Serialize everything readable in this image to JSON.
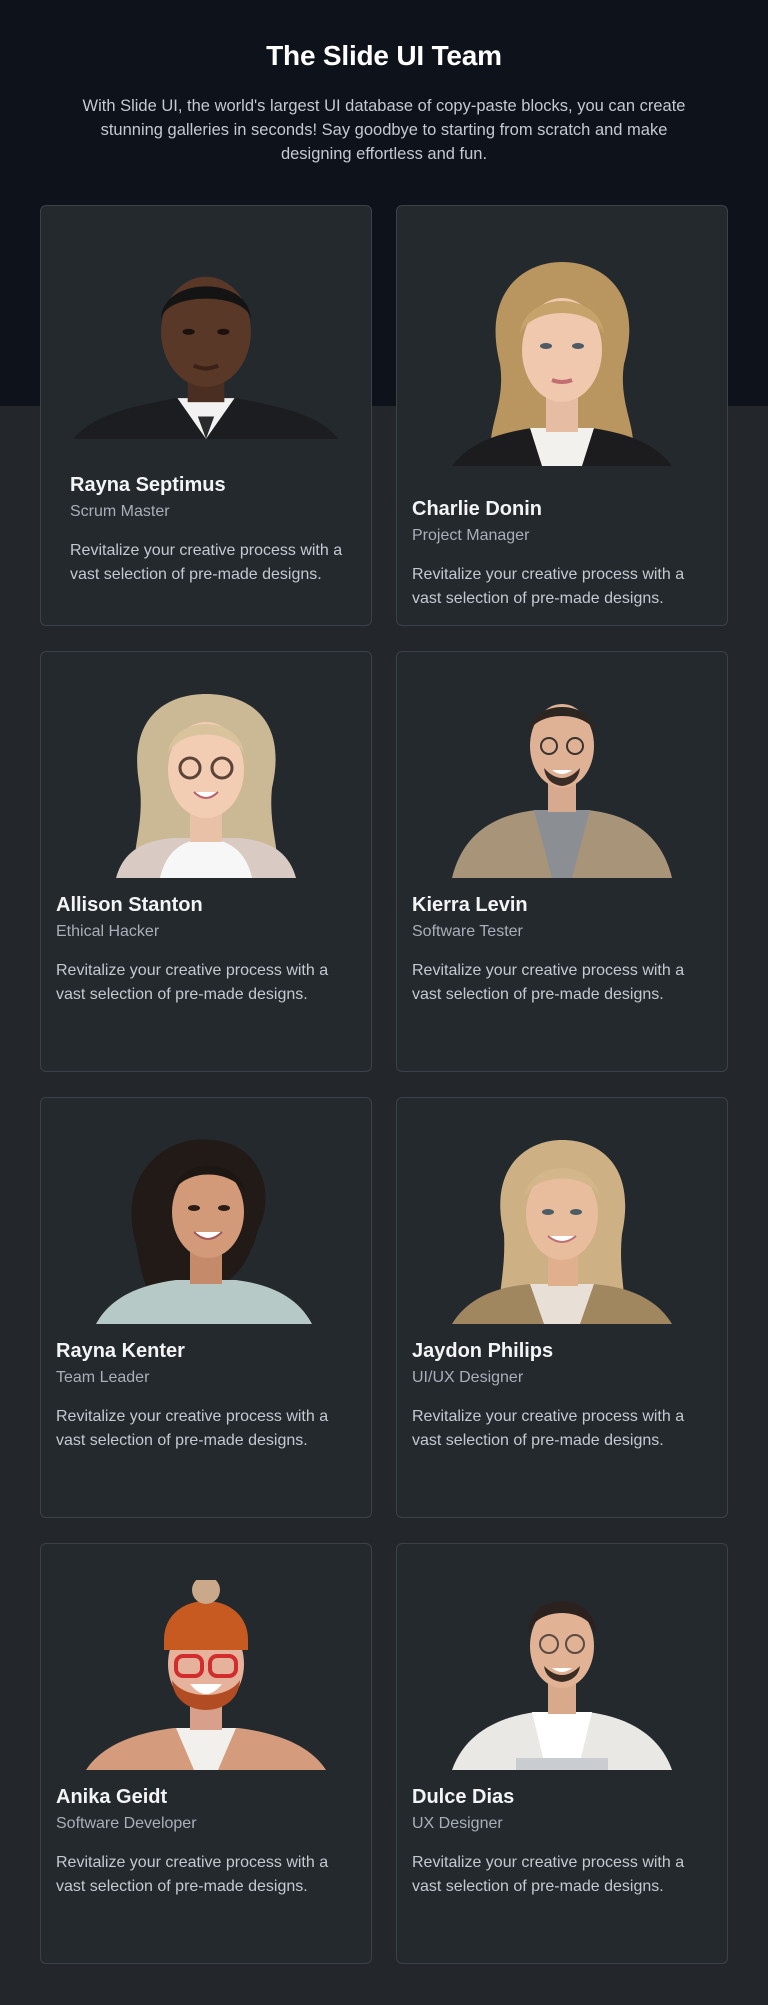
{
  "header": {
    "title": "The Slide UI Team",
    "subtitle": "With Slide UI, the world's largest UI database of copy-paste blocks, you can create stunning galleries in seconds! Say goodbye to starting from scratch and make designing effortless and fun."
  },
  "colors": {
    "hero_bg": "#0e121a",
    "page_bg": "#23272c",
    "card_bg": "#24292e",
    "card_border": "#3b4148"
  },
  "team": [
    {
      "name": "Rayna Septimus",
      "role": "Scrum Master",
      "description": "Revitalize your creative process with a vast selection of pre-made designs.",
      "photo": "portrait-man-suit"
    },
    {
      "name": "Charlie Donin",
      "role": "Project Manager",
      "description": "Revitalize your creative process with a vast selection of pre-made designs.",
      "photo": "portrait-woman-blazer"
    },
    {
      "name": "Allison Stanton",
      "role": "Ethical Hacker",
      "description": "Revitalize your creative process with a vast selection of pre-made designs.",
      "photo": "portrait-woman-glasses"
    },
    {
      "name": "Kierra Levin",
      "role": "Software Tester",
      "description": "Revitalize your creative process with a vast selection of pre-made designs.",
      "photo": "portrait-man-jacket"
    },
    {
      "name": "Rayna Kenter",
      "role": "Team Leader",
      "description": "Revitalize your creative process with a vast selection of pre-made designs.",
      "photo": "portrait-woman-curly"
    },
    {
      "name": "Jaydon Philips",
      "role": "UI/UX Designer",
      "description": "Revitalize your creative process with a vast selection of pre-made designs.",
      "photo": "portrait-woman-blonde"
    },
    {
      "name": "Anika Geidt",
      "role": "Software Developer",
      "description": "Revitalize your creative process with a vast selection of pre-made designs.",
      "photo": "portrait-man-beanie"
    },
    {
      "name": "Dulce Dias",
      "role": "UX Designer",
      "description": "Revitalize your creative process with a vast selection of pre-made designs.",
      "photo": "portrait-man-glasses"
    }
  ]
}
